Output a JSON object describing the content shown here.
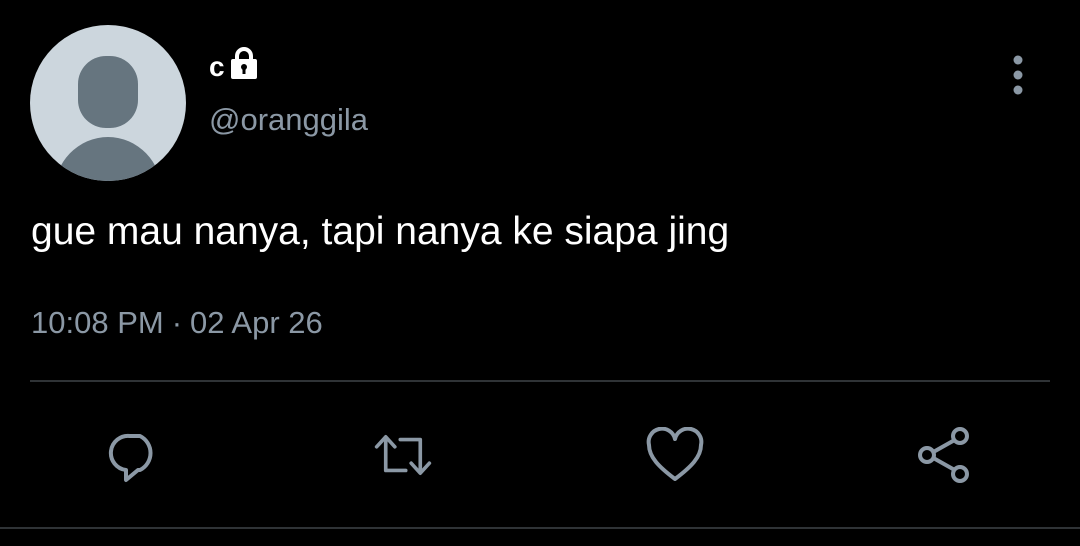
{
  "tweet": {
    "author": {
      "display_name": "c",
      "handle": "@oranggila",
      "protected_icon": "lock-icon",
      "avatar": "default-avatar"
    },
    "text": "gue mau nanya, tapi nanya ke siapa jing",
    "time": "10:08 PM",
    "separator": "·",
    "date": "02 Apr 26",
    "menu_icon": "more-vertical-icon"
  },
  "actions": [
    {
      "name": "reply",
      "icon": "reply-icon"
    },
    {
      "name": "retweet",
      "icon": "retweet-icon"
    },
    {
      "name": "like",
      "icon": "heart-icon"
    },
    {
      "name": "share",
      "icon": "share-icon"
    }
  ],
  "colors": {
    "background": "#000000",
    "text": "#ffffff",
    "secondary_text": "#8b98a5",
    "icon": "#8b98a5",
    "divider": "#2f3336",
    "avatar_bg": "#ccd6dd",
    "avatar_fg": "#66757f"
  }
}
